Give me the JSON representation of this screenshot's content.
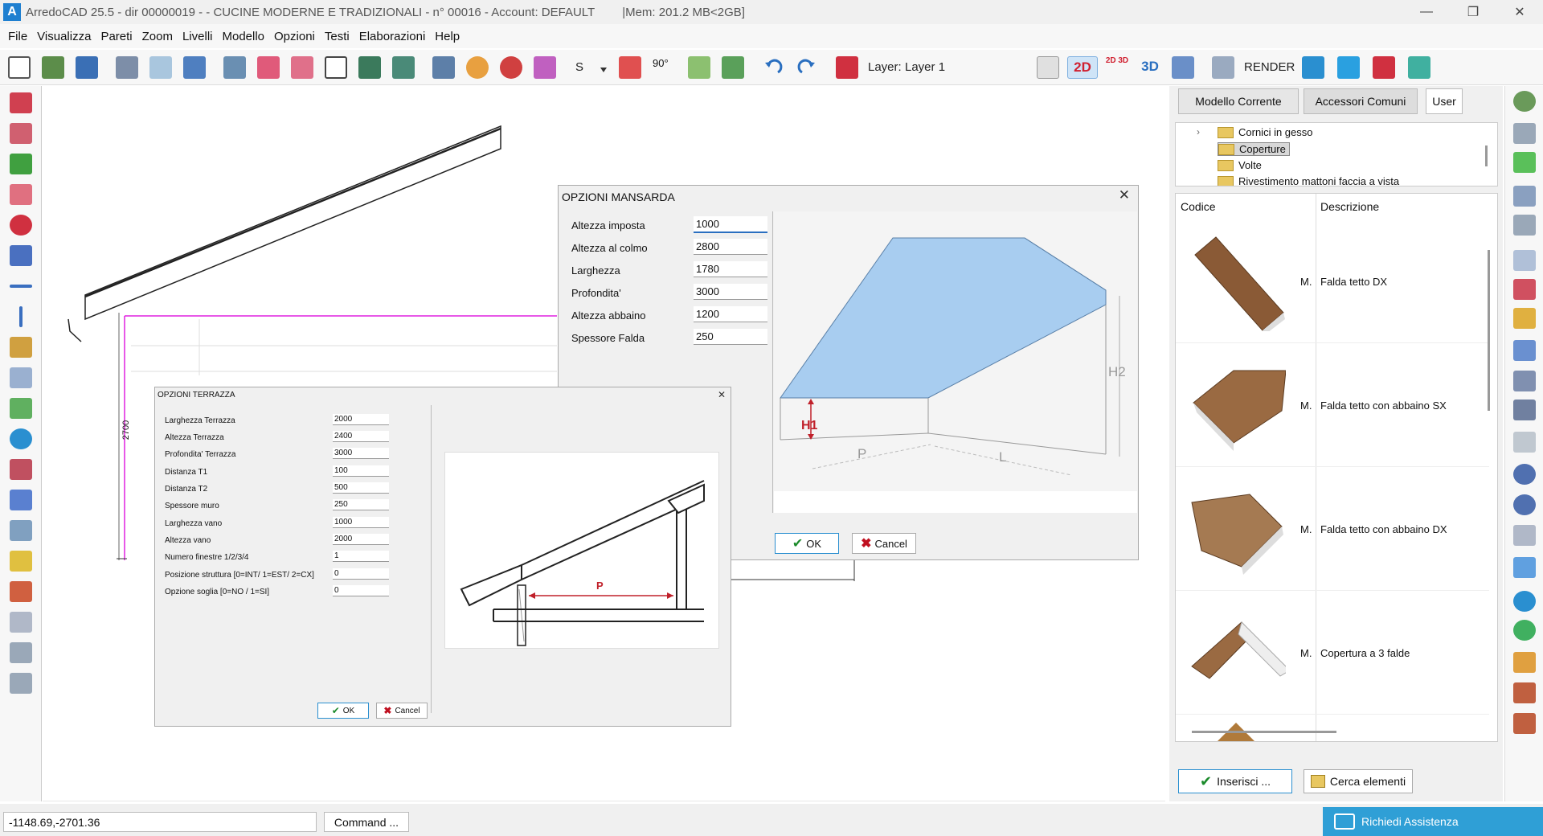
{
  "window": {
    "title": "ArredoCAD 25.5 - dir 00000019 -  - CUCINE MODERNE E TRADIZIONALI - n° 00016 - Account: DEFAULT",
    "mem": "|Mem: 201.2 MB<2GB]",
    "app_icon": "A"
  },
  "menu": [
    "File",
    "Visualizza",
    "Pareti",
    "Zoom",
    "Livelli",
    "Modello",
    "Opzioni",
    "Testi",
    "Elaborazioni",
    "Help"
  ],
  "toolbar": {
    "s_label": "S",
    "angle_label": "90°",
    "layer_label": "Layer:",
    "layer_value": "Layer 1",
    "view_2d": "2D",
    "view_2d3d": "2D 3D",
    "view_3d": "3D",
    "render": "RENDER"
  },
  "canvas": {
    "dimension_label": "2700"
  },
  "right_panel": {
    "tabs": [
      "Modello Corrente",
      "Accessori Comuni",
      "User"
    ],
    "tree": [
      "Cornici in gesso",
      "Coperture",
      "Volte",
      "Rivestimento mattoni faccia a vista"
    ],
    "tree_selected": "Coperture",
    "col_code": "Codice",
    "col_desc": "Descrizione",
    "items": [
      {
        "code": "M.",
        "desc": "Falda tetto DX"
      },
      {
        "code": "M.",
        "desc": "Falda tetto con abbaino SX"
      },
      {
        "code": "M.",
        "desc": "Falda tetto con abbaino DX"
      },
      {
        "code": "M.",
        "desc": "Copertura a 3 falde"
      }
    ],
    "insert_label": "Inserisci ...",
    "search_label": "Cerca elementi"
  },
  "mansarda": {
    "title": "OPZIONI MANSARDA",
    "fields": [
      {
        "label": "Altezza imposta",
        "value": "1000"
      },
      {
        "label": "Altezza al colmo",
        "value": "2800"
      },
      {
        "label": "Larghezza",
        "value": "1780"
      },
      {
        "label": "Profondita'",
        "value": "3000"
      },
      {
        "label": "Altezza abbaino",
        "value": "1200"
      },
      {
        "label": "Spessore Falda",
        "value": "250"
      }
    ],
    "ok": "OK",
    "cancel": "Cancel",
    "diagram": {
      "h1": "H1",
      "h2": "H2",
      "p": "P",
      "l": "L"
    }
  },
  "terrazza": {
    "title": "OPZIONI TERRAZZA",
    "fields": [
      {
        "label": "Larghezza Terrazza",
        "value": "2000"
      },
      {
        "label": "Altezza Terrazza",
        "value": "2400"
      },
      {
        "label": "Profondita' Terrazza",
        "value": "3000"
      },
      {
        "label": "Distanza T1",
        "value": "100"
      },
      {
        "label": "Distanza T2",
        "value": "500"
      },
      {
        "label": "Spessore muro",
        "value": "250"
      },
      {
        "label": "Larghezza vano",
        "value": "1000"
      },
      {
        "label": "Altezza vano",
        "value": "2000"
      },
      {
        "label": "Numero finestre 1/2/3/4",
        "value": "1"
      },
      {
        "label": "Posizione struttura [0=INT/ 1=EST/ 2=CX]",
        "value": "0"
      },
      {
        "label": "Opzione soglia [0=NO / 1=SI]",
        "value": "0"
      }
    ],
    "ok": "OK",
    "cancel": "Cancel",
    "diagram": {
      "p": "P"
    }
  },
  "status": {
    "coords": "-1148.69,-2701.36",
    "command": "Command ...",
    "assist": "Richiedi Assistenza"
  },
  "colors": {
    "accent": "#2f9fd6",
    "magenta": "#e020e0",
    "roof_blue": "#a8cdf0",
    "red": "#c0202a"
  }
}
